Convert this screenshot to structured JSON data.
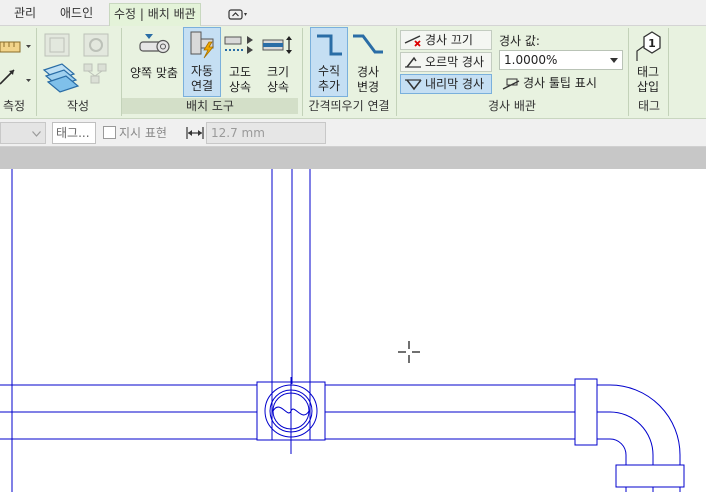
{
  "tabs": [
    {
      "label": "관리"
    },
    {
      "label": "애드인"
    },
    {
      "label": "수정 | 배치 배관",
      "active": true
    }
  ],
  "ribbon": {
    "left_panels": {
      "measure_title": "측정",
      "create_title": "작성"
    },
    "placement_tools": {
      "title": "배치 도구",
      "justify": {
        "line1": "양쪽 맞춤"
      },
      "auto_connect": {
        "line1": "자동",
        "line2": "연결",
        "selected": true
      },
      "inherit_elevation": {
        "line1": "고도",
        "line2": "상속"
      },
      "inherit_size": {
        "line1": "크기",
        "line2": "상속"
      }
    },
    "offset_connections": {
      "title": "간격띄우기 연결",
      "add_vertical": {
        "line1": "수직",
        "line2": "추가",
        "selected": true
      },
      "change_slope": {
        "line1": "경사",
        "line2": "변경"
      }
    },
    "sloped_piping": {
      "title": "경사 배관",
      "slope_off": "경사 끄기",
      "slope_up": "오르막 경사",
      "slope_down": "내리막 경사",
      "slope_down_selected": true,
      "slope_value_label": "경사 값:",
      "slope_value": "1.0000%",
      "show_slope_tooltip": "경사 툴팁 표시"
    },
    "tag": {
      "title": "태그",
      "tag_on_placement": {
        "line1": "태그",
        "line2": "삽입"
      }
    }
  },
  "options_bar": {
    "tag_orientation": "태그...",
    "leader_label": "지시 표현",
    "leader_checked": false,
    "leader_length": "12.7 mm"
  },
  "colors": {
    "ribbon_bg": "#e8f2e0",
    "selected_tool": "#c5dff3",
    "pipe_line": "#0000cc",
    "canvas_bg": "#ffffff"
  }
}
